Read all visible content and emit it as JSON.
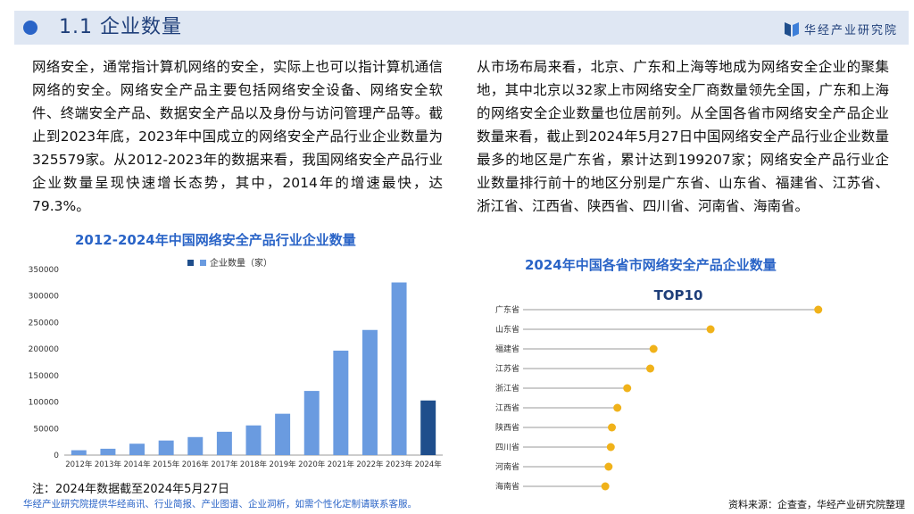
{
  "header": {
    "title": "1.1 企业数量",
    "brand": "华经产业研究院"
  },
  "paragraphs": {
    "left": "网络安全，通常指计算机网络的安全，实际上也可以指计算机通信网络的安全。网络安全产品主要包括网络安全设备、网络安全软件、终端安全产品、数据安全产品以及身份与访问管理产品等。截止到2023年底，2023年中国成立的网络安全产品行业企业数量为325579家。从2012-2023年的数据来看，我国网络安全产品行业企业数量呈现快速增长态势，其中，2014年的增速最快，达79.3%。",
    "right": "从市场布局来看，北京、广东和上海等地成为网络安全企业的聚集地，其中北京以32家上市网络安全厂商数量领先全国，广东和上海的网络安全企业数量也位居前列。从全国各省市网络安全产品企业数量来看，截止到2024年5月27日中国网络安全产品行业企业数量最多的地区是广东省，累计达到199207家；网络安全产品行业企业数量排行前十的地区分别是广东省、山东省、福建省、江苏省、浙江省、江西省、陕西省、四川省、河南省、海南省。"
  },
  "titles": {
    "left_chart": "2012-2024年中国网络安全产品行业企业数量",
    "right_chart": "2024年中国各省市网络安全产品企业数量"
  },
  "chart_data": [
    {
      "type": "bar",
      "title": "2012-2024年中国网络安全产品行业企业数量",
      "categories": [
        "2012年",
        "2013年",
        "2014年",
        "2015年",
        "2016年",
        "2017年",
        "2018年",
        "2019年",
        "2020年",
        "2021年",
        "2022年",
        "2023年",
        "2024年"
      ],
      "series": [
        {
          "name": "企业数量（家）",
          "values": [
            9200,
            12000,
            21500,
            27500,
            34000,
            44000,
            56000,
            78000,
            121000,
            197000,
            236000,
            325579,
            103000
          ]
        }
      ],
      "ylim": [
        0,
        350000
      ],
      "yticks": [
        0,
        50000,
        100000,
        150000,
        200000,
        250000,
        300000,
        350000
      ],
      "legend": "top",
      "colors": {
        "bar": "#6a9be0",
        "highlight": "#1f4e8c",
        "axis": "#999999"
      }
    },
    {
      "type": "scatter",
      "subtitle": "TOP10",
      "categories": [
        "广东省",
        "山东省",
        "福建省",
        "江苏省",
        "浙江省",
        "江西省",
        "陕西省",
        "四川省",
        "河南省",
        "海南省"
      ],
      "values": [
        199207,
        101000,
        49000,
        46000,
        25000,
        16000,
        11000,
        10000,
        8000,
        5000
      ],
      "xlim": [
        -70000,
        210000
      ],
      "colors": {
        "point": "#f0b21a",
        "line": "#9a9a9a"
      }
    }
  ],
  "note": "注：2024年数据截至2024年5月27日",
  "footer": {
    "left": "华经产业研究院提供华经商讯、行业简报、产业图谱、企业洞析，如需个性化定制请联系客服。",
    "right": "资料来源：企查查，华经产业研究院整理"
  }
}
